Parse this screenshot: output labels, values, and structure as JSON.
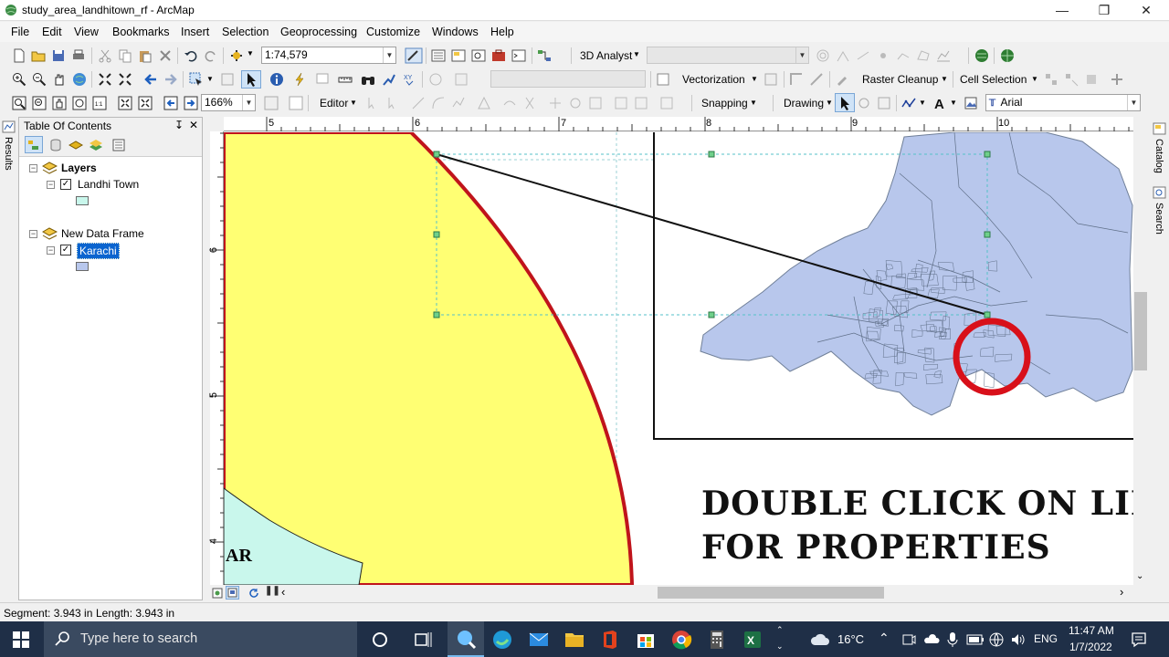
{
  "window": {
    "title": "study_area_landhitown_rf - ArcMap"
  },
  "menu": [
    "File",
    "Edit",
    "View",
    "Bookmarks",
    "Insert",
    "Selection",
    "Geoprocessing",
    "Customize",
    "Windows",
    "Help"
  ],
  "toolbar": {
    "scale_value": "1:74,579",
    "analyst_3d_label": "3D Analyst",
    "vectorization_label": "Vectorization",
    "raster_cleanup_label": "Raster Cleanup",
    "cell_selection_label": "Cell Selection",
    "zoom_value": "166%",
    "editor_label": "Editor",
    "snapping_label": "Snapping",
    "drawing_label": "Drawing",
    "font_value": "Arial"
  },
  "toc": {
    "title": "Table Of Contents",
    "pin_icon": "↧",
    "close_icon": "✕",
    "frames": [
      {
        "name": "Layers",
        "layers": [
          {
            "name": "Landhi Town",
            "checked": true,
            "color": "#c9f7ec"
          }
        ]
      },
      {
        "name": "New Data Frame",
        "layers": [
          {
            "name": "Karachi",
            "checked": true,
            "selected": true,
            "color": "#b8c7ec"
          }
        ]
      }
    ]
  },
  "side_tabs": {
    "left": "Results",
    "right_1": "Catalog",
    "right_2": "Search"
  },
  "ruler": {
    "top": [
      "5",
      "6",
      "7",
      "8",
      "9",
      "10"
    ],
    "left": [
      "6",
      "5",
      "4"
    ]
  },
  "map": {
    "overlay_line_1": "DOUBLE CLICK ON LINE",
    "overlay_line_2": "FOR PROPERTIES",
    "partial_label": "AR",
    "colors": {
      "study_area_fill": "#ffff73",
      "boundary": "#c0141b",
      "karachi_fill": "#b8c7ec",
      "landhi_fill": "#c9f7ec",
      "highlight_circle": "#d8101a"
    }
  },
  "status": {
    "segment": "Segment: 3.943 in",
    "length": "Length: 3.943 in"
  },
  "taskbar": {
    "search_placeholder": "Type here to search",
    "temperature": "16°C",
    "language": "ENG",
    "time": "11:47 AM",
    "date": "1/7/2022"
  }
}
